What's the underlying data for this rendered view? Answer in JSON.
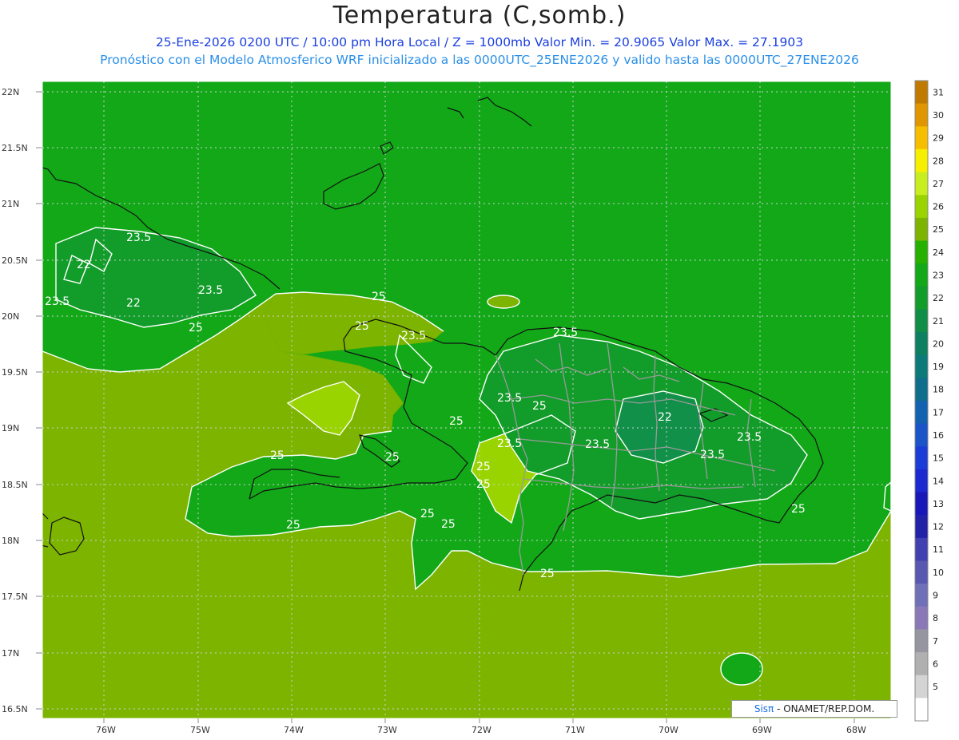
{
  "title": "Temperatura (C,somb.)",
  "subtitle_line1": "25-Ene-2026 0200 UTC / 10:00 pm Hora Local / Z = 1000mb   Valor Min. = 20.9065  Valor Max. = 27.1903",
  "subtitle_line2": "Pronóstico con el Modelo Atmosferico WRF inicializado a las 0000UTC_25ENE2026 y valido hasta las  0000UTC_27ENE2026",
  "latitude_labels": [
    "22N",
    "21.5N",
    "21N",
    "20.5N",
    "20N",
    "19.5N",
    "19N",
    "18.5N",
    "18N",
    "17.5N",
    "17N",
    "16.5N"
  ],
  "longitude_labels": [
    "76W",
    "75W",
    "74W",
    "73W",
    "72W",
    "71W",
    "70W",
    "69W",
    "68W"
  ],
  "contour_labels": [
    "23.5",
    "22",
    "23.5",
    "22",
    "23.5",
    "25",
    "25",
    "25",
    "23.5",
    "23.5",
    "25",
    "25",
    "23.5",
    "22",
    "23.5",
    "23.5",
    "25",
    "23.5",
    "25",
    "25",
    "25",
    "25",
    "25",
    "25",
    "25",
    "25",
    "23.5"
  ],
  "colorbar": {
    "values": [
      "31",
      "30",
      "29",
      "28",
      "27",
      "26",
      "25",
      "24",
      "23",
      "22",
      "21",
      "20",
      "19",
      "18",
      "17",
      "16",
      "15",
      "14",
      "13",
      "12",
      "11",
      "10",
      "9",
      "8",
      "7",
      "6",
      "5"
    ],
    "colors": [
      "#c07a00",
      "#e09600",
      "#f7be00",
      "#f6f000",
      "#c8ee20",
      "#9ad400",
      "#7cb400",
      "#26b000",
      "#12a818",
      "#129c2a",
      "#108e48",
      "#0c8060",
      "#0c7a78",
      "#0e6e8c",
      "#1262b0",
      "#1a54c8",
      "#1c3cd8",
      "#1c28d0",
      "#1818b8",
      "#2222a8",
      "#4040b0",
      "#5858b0",
      "#7070b8",
      "#8a78b8",
      "#9696a0",
      "#b0b0b0",
      "#d4d4d4",
      "#ffffff"
    ]
  },
  "credit": {
    "sis": "Sis",
    "pi": "π",
    "org": " - ONAMET/REP.DOM."
  }
}
